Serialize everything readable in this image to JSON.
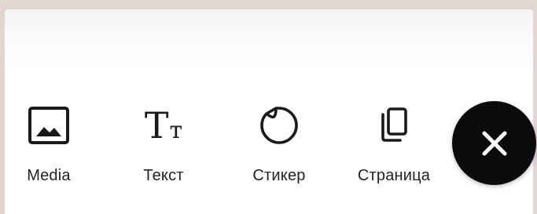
{
  "toolbar": {
    "items": [
      {
        "label": "Media",
        "icon": "image-icon"
      },
      {
        "label": "Текст",
        "icon": "text-icon"
      },
      {
        "label": "Стикер",
        "icon": "sticker-icon"
      },
      {
        "label": "Страница",
        "icon": "page-copy-icon"
      }
    ],
    "text_icon_big": "T",
    "text_icon_small": "т",
    "close_icon": "close-icon"
  },
  "colors": {
    "background": "#e2d6d1",
    "panel": "#ffffff",
    "icon": "#1a1a1a",
    "close_button": "#0b0b0b",
    "close_glyph": "#ffffff"
  }
}
